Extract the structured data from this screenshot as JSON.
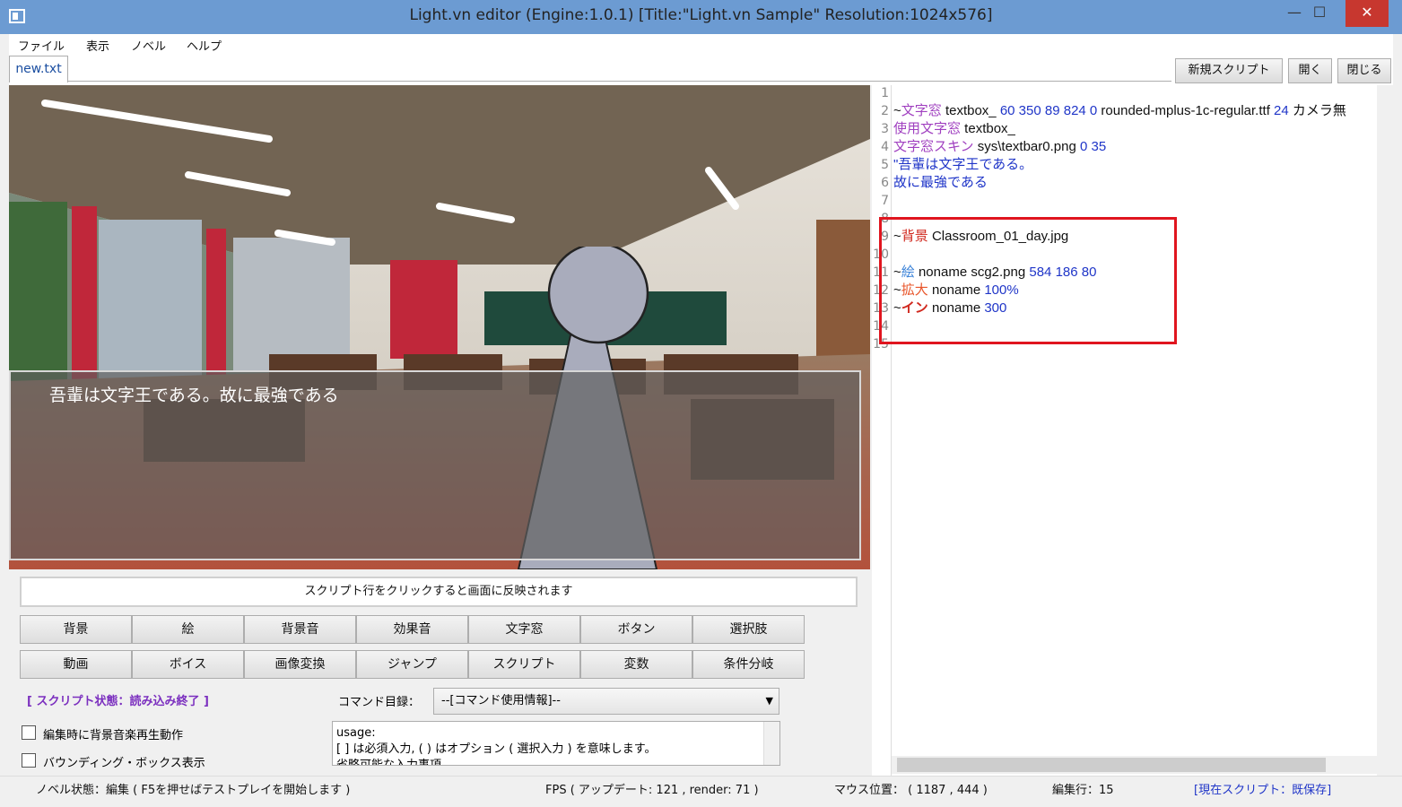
{
  "window": {
    "title": "Light.vn editor (Engine:1.0.1) [Title:\"Light.vn Sample\" Resolution:1024x576]",
    "minimize": "—",
    "maximize": "☐",
    "close": "✕"
  },
  "menu": [
    "ファイル",
    "表示",
    "ノベル",
    "ヘルプ"
  ],
  "tabs": {
    "active": "new.txt"
  },
  "toolbar": {
    "new_script": "新規スクリプト",
    "open": "開く",
    "close": "閉じる"
  },
  "preview": {
    "message": "吾輩は文字王である。故に最強である"
  },
  "hint": "スクリプト行をクリックすると画面に反映されます",
  "commands_row1": [
    "背景",
    "絵",
    "背景音",
    "効果音",
    "文字窓",
    "ボタン",
    "選択肢"
  ],
  "commands_row2": [
    "動画",
    "ボイス",
    "画像変換",
    "ジャンプ",
    "スクリプト",
    "変数",
    "条件分岐"
  ],
  "script_state": "[ スクリプト状態：読み込み終了 ]",
  "command_list": {
    "label": "コマンド目録：",
    "selected": "--[コマンド使用情報]--"
  },
  "checkboxes": [
    "編集時に背景音楽再生動作",
    "バウンディング・ボックス表示"
  ],
  "usage": [
    "usage:",
    "[ ] は必須入力, ( ) はオプション ( 選択入力 ) を意味します。",
    "省略可能な入力事項"
  ],
  "editor": {
    "line_numbers": [
      "1",
      "2",
      "3",
      "4",
      "5",
      "6",
      "7",
      "8",
      "9",
      "10",
      "11",
      "12",
      "13",
      "14",
      "15"
    ],
    "lines": [
      {
        "parts": []
      },
      {
        "parts": [
          {
            "t": "~",
            "c": "black"
          },
          {
            "t": "文字窓",
            "c": "purple"
          },
          {
            "t": " textbox_ ",
            "c": "black"
          },
          {
            "t": "60 350 89 824 0",
            "c": "blue"
          },
          {
            "t": " rounded-mplus-1c-regular.ttf ",
            "c": "black"
          },
          {
            "t": "24",
            "c": "blue"
          },
          {
            "t": " カメラ無",
            "c": "black"
          }
        ]
      },
      {
        "parts": [
          {
            "t": "使用文字窓",
            "c": "purple"
          },
          {
            "t": " textbox_",
            "c": "black"
          }
        ]
      },
      {
        "parts": [
          {
            "t": "文字窓スキン",
            "c": "purple"
          },
          {
            "t": " sys\\textbar0.png ",
            "c": "black"
          },
          {
            "t": "0 35",
            "c": "blue"
          }
        ]
      },
      {
        "parts": [
          {
            "t": "\"吾輩は文字王である。",
            "c": "blue"
          }
        ]
      },
      {
        "parts": [
          {
            "t": "故に最強である",
            "c": "blue"
          }
        ]
      },
      {
        "parts": []
      },
      {
        "parts": []
      },
      {
        "parts": [
          {
            "t": "~",
            "c": "black"
          },
          {
            "t": "背景",
            "c": "red"
          },
          {
            "t": " Classroom_01_day.jpg",
            "c": "black"
          }
        ]
      },
      {
        "parts": []
      },
      {
        "parts": [
          {
            "t": "~",
            "c": "black"
          },
          {
            "t": "絵",
            "c": "lblue"
          },
          {
            "t": " noname scg2.png ",
            "c": "black"
          },
          {
            "t": "584 186 80",
            "c": "blue"
          }
        ]
      },
      {
        "parts": [
          {
            "t": "~",
            "c": "black"
          },
          {
            "t": "拡大",
            "c": "orange"
          },
          {
            "t": " noname ",
            "c": "black"
          },
          {
            "t": "100%",
            "c": "blue"
          }
        ]
      },
      {
        "parts": [
          {
            "t": "~",
            "c": "black"
          },
          {
            "t": "イン",
            "c": "red bold"
          },
          {
            "t": " noname ",
            "c": "black"
          },
          {
            "t": "300",
            "c": "blue"
          }
        ]
      },
      {
        "parts": []
      },
      {
        "parts": []
      }
    ]
  },
  "status": {
    "novel_state": "ノベル状態：編集 ( F5を押せばテストプレイを開始します )",
    "fps": "FPS ( アップデート: 121 , render: 71 )",
    "mouse": "マウス位置： ( 1187 , 444 )",
    "edit_line": "編集行：15",
    "current_script": "[現在スクリプト：既保存]"
  },
  "colors": {
    "titlebar": "#6c9bd2",
    "close": "#c7372f",
    "highlight_box": "#e0151f",
    "script_state": "#7b2fbf"
  }
}
